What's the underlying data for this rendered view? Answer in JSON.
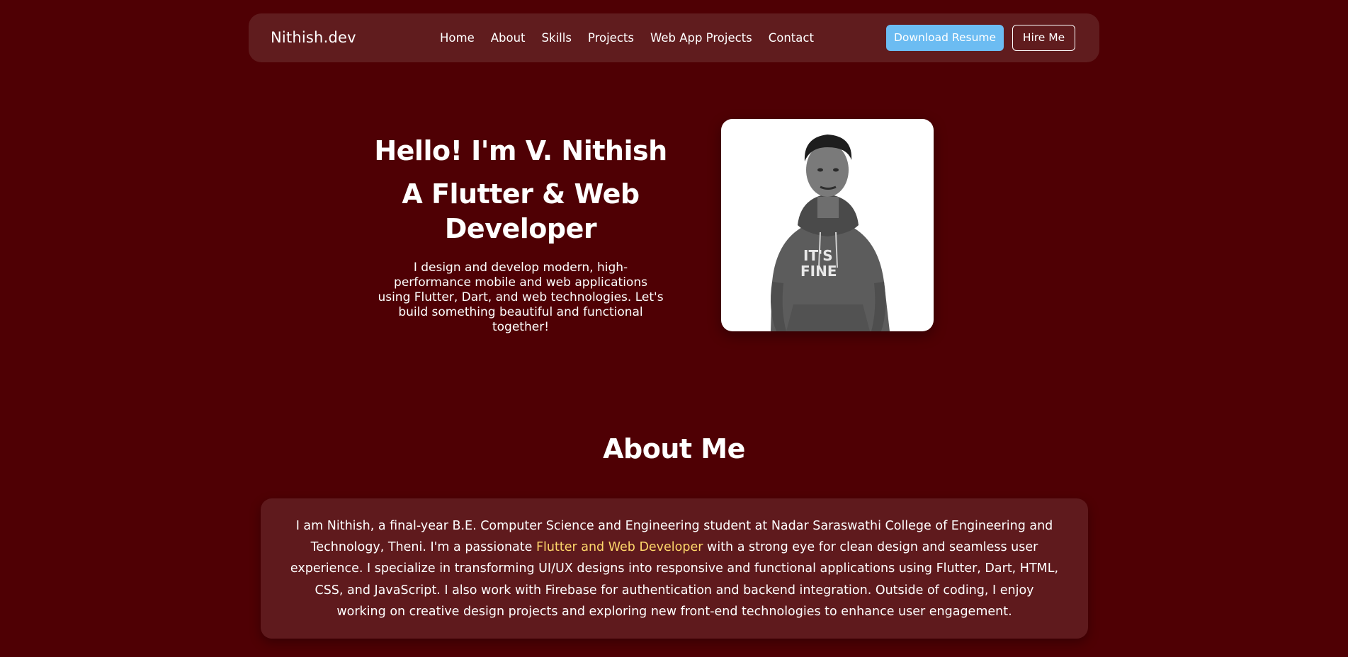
{
  "nav": {
    "brand": "Nithish.dev",
    "links": [
      "Home",
      "About",
      "Skills",
      "Projects",
      "Web App Projects",
      "Contact"
    ],
    "download_label": "Download Resume",
    "hire_label": "Hire Me"
  },
  "hero": {
    "greeting": "Hello! I'm V. Nithish",
    "role": "A Flutter & Web Developer",
    "description": "I design and develop modern, high-performance mobile and web applications using Flutter, Dart, and web technologies. Let's build something beautiful and functional together!",
    "photo_print_line1": "IT'S",
    "photo_print_line2": "FINE"
  },
  "about": {
    "title": "About Me",
    "text_before": "I am Nithish, a final-year B.E. Computer Science and Engineering student at Nadar Saraswathi College of Engineering and Technology, Theni. I'm a passionate ",
    "highlight": "Flutter and Web Developer",
    "text_after": " with a strong eye for clean design and seamless user experience. I specialize in transforming UI/UX designs into responsive and functional applications using Flutter, Dart, HTML, CSS, and JavaScript. I also work with Firebase for authentication and backend integration. Outside of coding, I enjoy working on creative design projects and exploring new front-end technologies to enhance user engagement."
  },
  "colors": {
    "page_bg": "#4f0004",
    "card_bg": "#601c1e",
    "accent_blue": "#6cbcf2",
    "highlight_yellow": "#ffd86b"
  }
}
